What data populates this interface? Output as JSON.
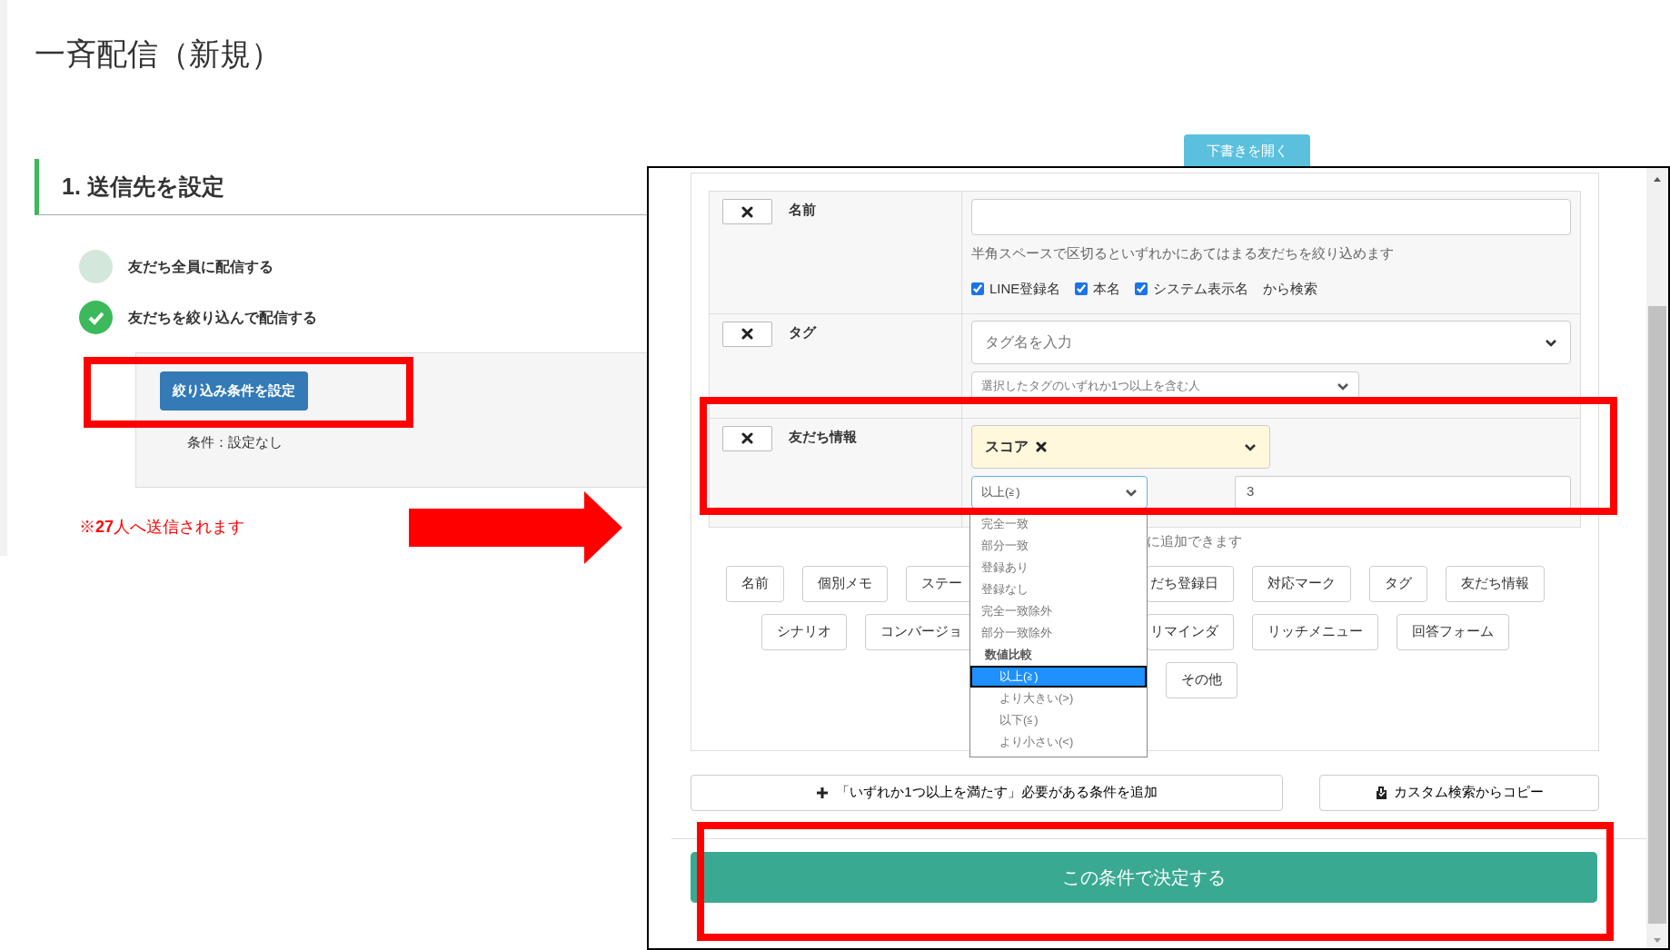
{
  "page": {
    "title": "一斉配信（新規）",
    "section_title": "1. 送信先を設定",
    "recipient_options": [
      {
        "label": "友だち全員に配信する",
        "selected": false
      },
      {
        "label": "友だちを絞り込んで配信する",
        "selected": true
      }
    ],
    "filter_button": "絞り込み条件を設定",
    "condition_text": "条件：設定なし",
    "send_notice": "※**27**人へ送信されます"
  },
  "draft_button": "下書きを開く",
  "dialog": {
    "conditions": [
      {
        "kind": "name",
        "label": "名前",
        "hint": "半角スペースで区切るといずれかにあてはまる友だちを絞り込めます",
        "checks": [
          {
            "label": "LINE登録名",
            "checked": true
          },
          {
            "label": "本名",
            "checked": true
          },
          {
            "label": "システム表示名",
            "checked": true
          }
        ],
        "suffix": "から検索"
      },
      {
        "kind": "tag",
        "label": "タグ",
        "placeholder": "タグ名を入力",
        "match": "選択したタグのいずれか1つ以上を含む人"
      },
      {
        "kind": "friend_info",
        "label": "友だち情報",
        "field": "スコア",
        "operator": "以上(≧)",
        "value": "3",
        "expanded": true,
        "options": [
          {
            "kind": "option",
            "label": "完全一致",
            "selected": false
          },
          {
            "kind": "option",
            "label": "部分一致",
            "selected": false
          },
          {
            "kind": "option",
            "label": "登録あり",
            "selected": false
          },
          {
            "kind": "option",
            "label": "登録なし",
            "selected": false
          },
          {
            "kind": "option",
            "label": "完全一致除外",
            "selected": false
          },
          {
            "kind": "option",
            "label": "部分一致除外",
            "selected": false
          },
          {
            "kind": "group",
            "label": "数値比較",
            "options": [
              {
                "kind": "option",
                "label": "以上(≧)",
                "selected": true
              },
              {
                "kind": "option",
                "label": "より大きい(>)",
                "selected": false
              },
              {
                "kind": "option",
                "label": "以下(≦)",
                "selected": false
              },
              {
                "kind": "option",
                "label": "より小さい(<)",
                "selected": false
              }
            ]
          }
        ]
      }
    ],
    "add_hint": "に追加できます",
    "tag_button_rows": [
      {
        "left_of_menu": [
          {
            "label": "名前",
            "clipped": false
          },
          {
            "label": "個別メモ",
            "clipped": false
          },
          {
            "label": "ステー",
            "clipped": true
          }
        ],
        "right_of_menu": [
          {
            "label": "だち登録日",
            "clipped": true
          },
          {
            "label": "対応マーク",
            "clipped": false
          },
          {
            "label": "タグ",
            "clipped": false
          },
          {
            "label": "友だち情報",
            "clipped": false
          }
        ]
      },
      {
        "left_of_menu": [
          {
            "label": "シナリオ",
            "clipped": false
          },
          {
            "label": "コンバージョ",
            "clipped": true
          }
        ],
        "right_of_menu": [
          {
            "label": "リマインダ",
            "clipped": true
          },
          {
            "label": "リッチメニュー",
            "clipped": false
          },
          {
            "label": "回答フォーム",
            "clipped": false
          }
        ]
      },
      {
        "left_of_menu": [],
        "right_of_menu": [
          {
            "label": "その他",
            "clipped": false
          }
        ]
      }
    ],
    "or_button": "「いずれか1つ以上を満たす」必要がある条件を追加",
    "copy_button": "カスタム検索からコピー",
    "submit_button": "この条件で決定する"
  }
}
